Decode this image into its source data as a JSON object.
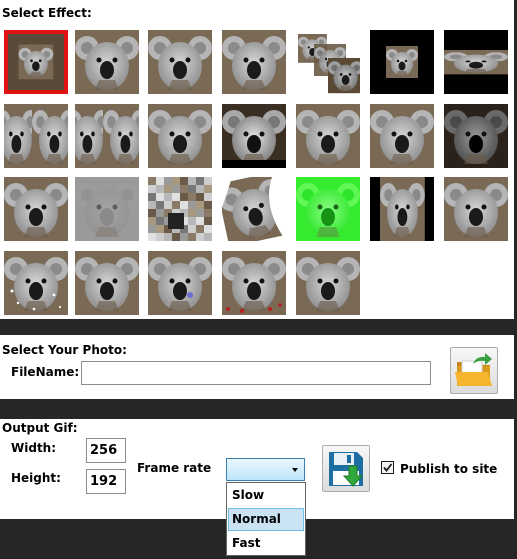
{
  "effects_section": {
    "title": "Select Effect:",
    "thumbnails": [
      {
        "effect": "zoom-out",
        "selected": true
      },
      {
        "effect": "normal",
        "selected": false
      },
      {
        "effect": "normal",
        "selected": false
      },
      {
        "effect": "normal",
        "selected": false
      },
      {
        "effect": "perspective-tunnel",
        "selected": false
      },
      {
        "effect": "shrink-center",
        "selected": false
      },
      {
        "effect": "horizontal-squash",
        "selected": false
      },
      {
        "effect": "tiled",
        "selected": false
      },
      {
        "effect": "tiled",
        "selected": false
      },
      {
        "effect": "normal",
        "selected": false
      },
      {
        "effect": "dark-edge",
        "selected": false
      },
      {
        "effect": "normal",
        "selected": false
      },
      {
        "effect": "normal",
        "selected": false
      },
      {
        "effect": "dark",
        "selected": false
      },
      {
        "effect": "normal",
        "selected": false
      },
      {
        "effect": "emboss",
        "selected": false
      },
      {
        "effect": "pixelate",
        "selected": false
      },
      {
        "effect": "page-curl",
        "selected": false
      },
      {
        "effect": "green-tint",
        "selected": false
      },
      {
        "effect": "black-border",
        "selected": false
      },
      {
        "effect": "normal",
        "selected": false
      },
      {
        "effect": "snow",
        "selected": false
      },
      {
        "effect": "normal",
        "selected": false
      },
      {
        "effect": "sparkle-blue",
        "selected": false
      },
      {
        "effect": "sparkle-red",
        "selected": false
      },
      {
        "effect": "normal",
        "selected": false
      }
    ]
  },
  "photo_section": {
    "title": "Select Your Photo:",
    "filename_label": "FileName:",
    "filename_value": "",
    "browse_icon": "open-folder-icon"
  },
  "output_section": {
    "title": "Output Gif:",
    "width_label": "Width:",
    "width_value": "256",
    "height_label": "Height:",
    "height_value": "192",
    "frame_rate_label": "Frame rate",
    "frame_rate_selected": "",
    "frame_rate_options": [
      "Slow",
      "Normal",
      "Fast"
    ],
    "frame_rate_highlighted": "Normal",
    "save_icon": "save-disk-icon",
    "publish_label": "Publish to site",
    "publish_checked": true
  },
  "colors": {
    "background": "#262626",
    "panel": "#ffffff",
    "selection_border": "#e01212",
    "dropdown_highlight": "#c9e3f3"
  }
}
